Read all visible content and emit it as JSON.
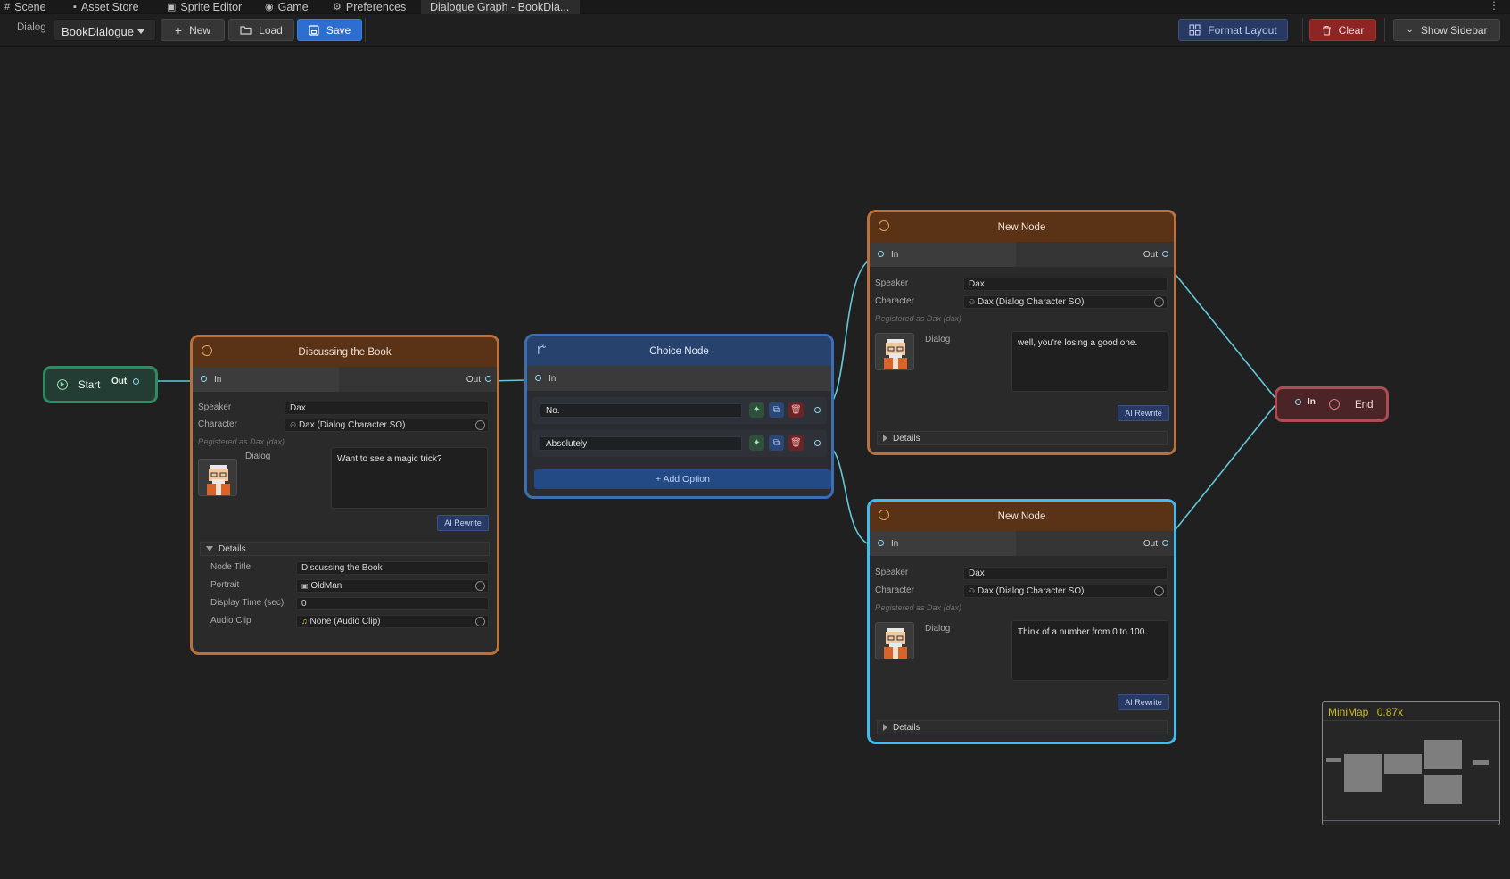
{
  "tabs": [
    {
      "label": "Scene",
      "icon": "grid-icon"
    },
    {
      "label": "Asset Store",
      "icon": "bag-icon"
    },
    {
      "label": "Sprite Editor",
      "icon": "sprite-icon"
    },
    {
      "label": "Game",
      "icon": "gamepad-icon"
    },
    {
      "label": "Preferences",
      "icon": "gear-icon"
    },
    {
      "label": "Dialogue Graph - BookDia...",
      "icon": ""
    }
  ],
  "toolbar": {
    "dialog_label": "Dialog",
    "dialog_select": "BookDialogue",
    "new_label": "New",
    "load_label": "Load",
    "save_label": "Save",
    "format_label": "Format Layout",
    "clear_label": "Clear",
    "sidebar_label": "Show Sidebar"
  },
  "start": {
    "label": "Start",
    "out": "Out"
  },
  "end": {
    "label": "End",
    "in": "In"
  },
  "node1": {
    "title": "Discussing the Book",
    "in": "In",
    "out": "Out",
    "speaker_label": "Speaker",
    "speaker": "Dax",
    "character_label": "Character",
    "character": "Dax (Dialog Character SO)",
    "registered": "Registered as Dax (dax)",
    "dialog_label": "Dialog",
    "dialog": "Want to see a magic trick?",
    "ai": "AI Rewrite",
    "details": "Details",
    "node_title_label": "Node Title",
    "node_title": "Discussing the Book",
    "portrait_label": "Portrait",
    "portrait": "OldMan",
    "display_time_label": "Display Time (sec)",
    "display_time": "0",
    "audio_label": "Audio Clip",
    "audio": "None (Audio Clip)"
  },
  "choice": {
    "title": "Choice Node",
    "in": "In",
    "options": [
      "No.",
      "Absolutely"
    ],
    "add": "+ Add Option"
  },
  "node2": {
    "title": "New Node",
    "in": "In",
    "out": "Out",
    "speaker_label": "Speaker",
    "speaker": "Dax",
    "character_label": "Character",
    "character": "Dax (Dialog Character SO)",
    "registered": "Registered as Dax (dax)",
    "dialog_label": "Dialog",
    "dialog": "well, you're losing a good one.",
    "ai": "AI Rewrite",
    "details": "Details"
  },
  "node3": {
    "title": "New Node",
    "in": "In",
    "out": "Out",
    "speaker_label": "Speaker",
    "speaker": "Dax",
    "character_label": "Character",
    "character": "Dax (Dialog Character SO)",
    "registered": "Registered as Dax (dax)",
    "dialog_label": "Dialog",
    "dialog": "Think of a number from 0 to 100.",
    "ai": "AI Rewrite",
    "details": "Details"
  },
  "minimap": {
    "title": "MiniMap",
    "zoom": "0.87x"
  },
  "colors": {
    "background": "#202020",
    "dialog_node_border": "#b8713f",
    "selected_node_border": "#3fbcf2",
    "choice_node_border": "#3d6eb3",
    "start_border": "#2f8a66",
    "end_border": "#b04b54",
    "edge": "#63c7d9",
    "accent_save": "#2d6fd0"
  }
}
